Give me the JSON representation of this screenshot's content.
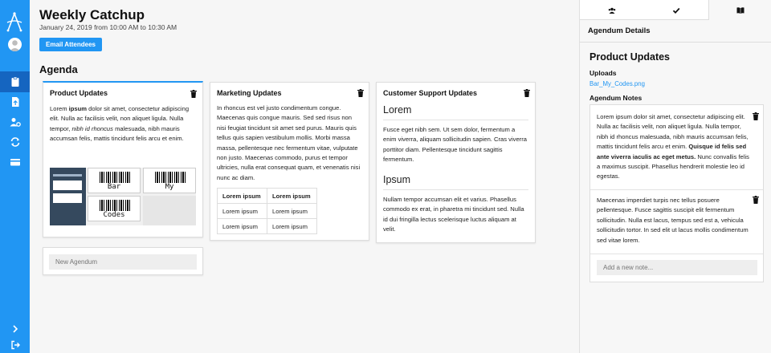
{
  "sidebar": {
    "logo_icon": "logo-a-icon",
    "items": [
      {
        "icon": "clipboard-icon",
        "active": true
      },
      {
        "icon": "file-upload-icon",
        "active": false
      },
      {
        "icon": "users-cog-icon",
        "active": false
      },
      {
        "icon": "sync-icon",
        "active": false
      },
      {
        "icon": "credit-card-icon",
        "active": false
      }
    ],
    "bottom": [
      {
        "icon": "chevron-right-icon"
      },
      {
        "icon": "sign-out-icon"
      }
    ],
    "accent_color": "#2196f3"
  },
  "meeting": {
    "title": "Weekly Catchup",
    "date": "January 24, 2019",
    "from_word": "from",
    "start": "10:00 AM",
    "to_word": "to",
    "end": "10:30 AM",
    "email_button": "Email Attendees"
  },
  "agenda": {
    "heading": "Agenda",
    "new_placeholder": "New Agendum",
    "cards": [
      {
        "title": "Product Updates",
        "text_a": "Lorem ",
        "text_b": "ipsum",
        "text_c": " dolor sit amet, consectetur adipiscing elit. Nulla ac facilisis velit, non aliquet ligula. Nulla tempor, ",
        "text_d": "nibh id rhoncus",
        "text_e": " malesuada, nibh mauris accumsan felis, mattis tincidunt felis arcu et enim.",
        "thumbs": [
          "Bar",
          "My",
          "Codes"
        ]
      },
      {
        "title": "Marketing Updates",
        "text": "In rhoncus est vel justo condimentum congue. Maecenas quis congue mauris. Sed sed risus non nisi feugiat tincidunt sit amet sed purus. Mauris quis tellus quis sapien vestibulum mollis. Morbi massa massa, pellentesque nec fermentum vitae, vulputate non justo. Maecenas commodo, purus et tempor ultricies, nulla erat consequat quam, et venenatis nisi nunc ac diam.",
        "table": [
          [
            "Lorem ipsum",
            "Lorem ipsum"
          ],
          [
            "Lorem ipsum",
            "Lorem ipsum"
          ],
          [
            "Lorem ipsum",
            "Lorem ipsum"
          ]
        ]
      },
      {
        "title": "Customer Support Updates",
        "heading1": "Lorem",
        "text1": "Fusce eget nibh sem. Ut sem dolor, fermentum a enim viverra, aliquam sollicitudin sapien. Cras viverra porttitor diam. Pellentesque tincidunt sagittis fermentum.",
        "heading2": "Ipsum",
        "text2": "Nullam tempor accumsan elit et varius. Phasellus commodo ex erat, in pharetra mi tincidunt sed. Nulla id dui fringilla lectus scelerisque luctus aliquam at velit."
      }
    ]
  },
  "panel": {
    "tab_icons": [
      "users-icon",
      "check-icon",
      "book-icon"
    ],
    "header": "Agendum Details",
    "title": "Product Updates",
    "uploads_label": "Uploads",
    "upload_file": "Bar_My_Codes.png",
    "notes_label": "Agendum Notes",
    "note1_a": "Lorem ipsum dolor sit amet, consectetur adipiscing elit. Nulla ac facilisis velit, non aliquet ligula. Nulla tempor, nibh id rhoncus malesuada, nibh mauris accumsan felis, mattis tincidunt felis arcu et enim. ",
    "note1_b": "Quisque id felis sed ante viverra iaculis ac eget metus.",
    "note1_c": " Nunc convallis felis a maximus suscipit. Phasellus hendrerit molestie leo id egestas.",
    "note2": "Maecenas imperdiet turpis nec tellus posuere pellentesque. Fusce sagittis suscipit elit fermentum sollicitudin. Nulla est lacus, tempus sed est a, vehicula sollicitudin tortor. In sed elit ut lacus mollis condimentum sed vitae lorem.",
    "note_placeholder": "Add a new note..."
  }
}
